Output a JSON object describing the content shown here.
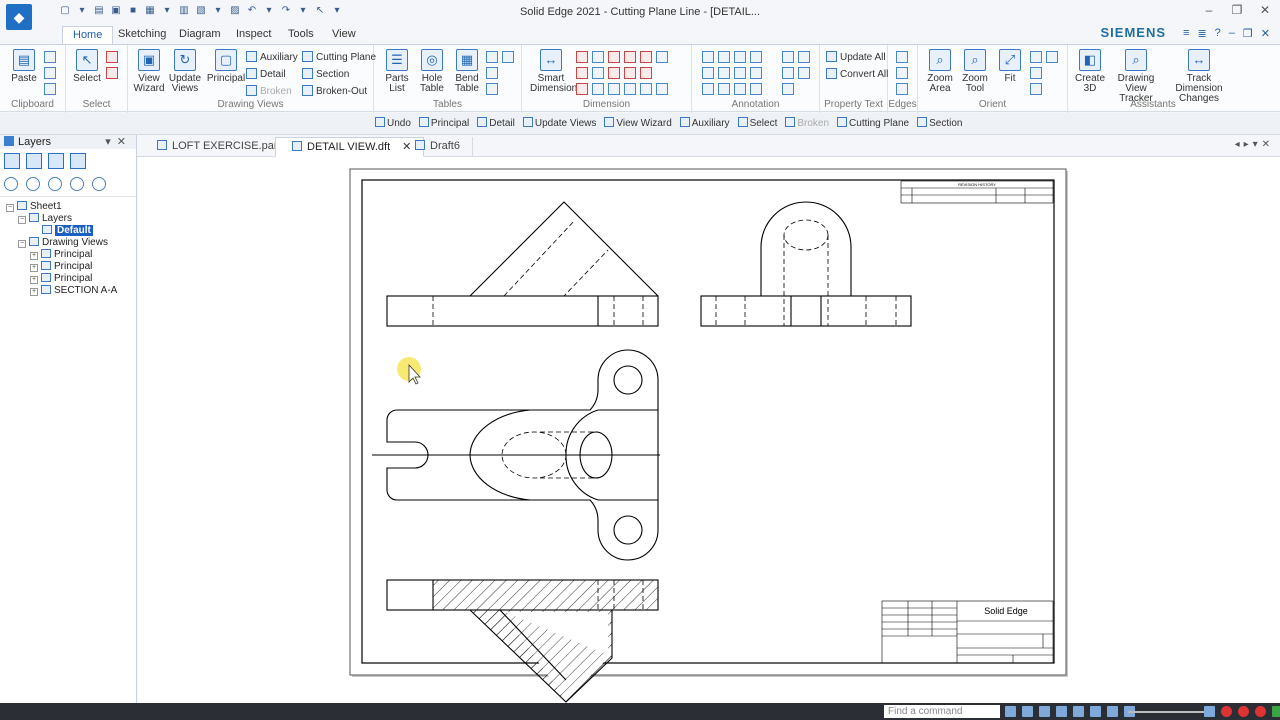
{
  "app": {
    "window_title": "Solid Edge 2021 - Cutting Plane Line - [DETAIL...",
    "brand": "SIEMENS"
  },
  "menu": {
    "tabs": [
      "Home",
      "Sketching",
      "Diagram",
      "Inspect",
      "Tools",
      "View"
    ],
    "active": "Home"
  },
  "ribbon": {
    "clipboard": {
      "label": "Clipboard",
      "paste": "Paste"
    },
    "select": {
      "label": "Select",
      "select": "Select"
    },
    "drawing_views": {
      "label": "Drawing Views",
      "view_wizard": "View Wizard",
      "update_views": "Update Views",
      "principal": "Principal",
      "auxiliary": "Auxiliary",
      "detail": "Detail",
      "broken": "Broken",
      "cutting_plane": "Cutting Plane",
      "section": "Section",
      "broken_out": "Broken-Out"
    },
    "tables": {
      "label": "Tables",
      "parts_list": "Parts List",
      "hole_table": "Hole Table",
      "bend_table": "Bend Table"
    },
    "dimension": {
      "label": "Dimension",
      "smart_dimension": "Smart Dimension"
    },
    "annotation": {
      "label": "Annotation"
    },
    "property_text": {
      "label": "Property Text",
      "update_all": "Update All",
      "convert_all": "Convert All"
    },
    "edges": {
      "label": "Edges"
    },
    "orient": {
      "label": "Orient",
      "zoom_area": "Zoom Area",
      "zoom_tool": "Zoom Tool",
      "fit": "Fit"
    },
    "assistants": {
      "label": "Assistants",
      "create_3d": "Create 3D",
      "drawing_view_tracker": "Drawing View Tracker",
      "track_dimension_changes": "Track Dimension Changes"
    }
  },
  "command_bar": {
    "undo": "Undo",
    "principal": "Principal",
    "detail": "Detail",
    "update_views": "Update Views",
    "view_wizard": "View Wizard",
    "auxiliary": "Auxiliary",
    "select": "Select",
    "broken": "Broken",
    "cutting_plane": "Cutting Plane",
    "section": "Section"
  },
  "layers_panel": {
    "title": "Layers",
    "tree": {
      "sheet": "Sheet1",
      "layers": "Layers",
      "default_layer": "Default",
      "drawing_views": "Drawing Views",
      "views": [
        "Principal",
        "Principal",
        "Principal",
        "SECTION A-A"
      ]
    }
  },
  "doc_tabs": [
    {
      "label": "LOFT EXERCISE.par",
      "active": false
    },
    {
      "label": "DETAIL VIEW.dft",
      "active": true
    },
    {
      "label": "Draft6",
      "active": false
    }
  ],
  "title_block": {
    "company": "Solid Edge",
    "revision_history": "REVISION HISTORY"
  },
  "status_bar": {
    "find_placeholder": "Find a command"
  },
  "colors": {
    "accent": "#1f5fa8",
    "selection": "#1a5fc2",
    "statusbar": "#2b2f35"
  }
}
